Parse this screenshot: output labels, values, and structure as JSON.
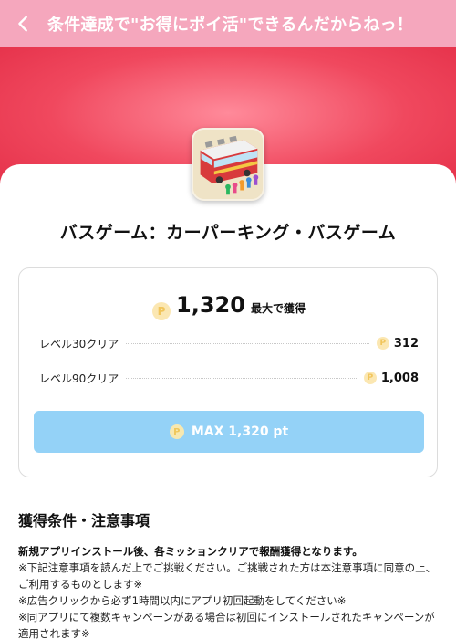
{
  "header": {
    "title": "条件達成で\"お得にポイ活\"できるんだからねっ！"
  },
  "app": {
    "name": "バスゲーム：カーパーキング・バスゲーム",
    "icon": "bus-game-app-icon"
  },
  "reward": {
    "coin_symbol": "P",
    "total_value": "1,320",
    "total_label": "最大で獲得",
    "missions": [
      {
        "label": "レベル30クリア",
        "points": "312"
      },
      {
        "label": "レベル90クリア",
        "points": "1,008"
      }
    ],
    "max_button_label": "MAX 1,320 pt"
  },
  "conditions": {
    "heading": "獲得条件・注意事項",
    "lead": "新規アプリインストール後、各ミッションクリアで報酬獲得となります。",
    "notes": [
      "※下記注意事項を読んだ上でご挑戦ください。ご挑戦された方は本注意事項に同意の上、ご利用するものとします※",
      "※広告クリックから必ず1時間以内にアプリ初回起動をしてください※",
      "※同アプリにて複数キャンペーンがある場合は初回にインストールされたキャンペーンが適用されます※"
    ]
  },
  "colors": {
    "header_bg": "#f5a7bd",
    "hero_red": "#e42f48",
    "button_blue": "#94d2f7",
    "coin": "#fbe7b2"
  }
}
